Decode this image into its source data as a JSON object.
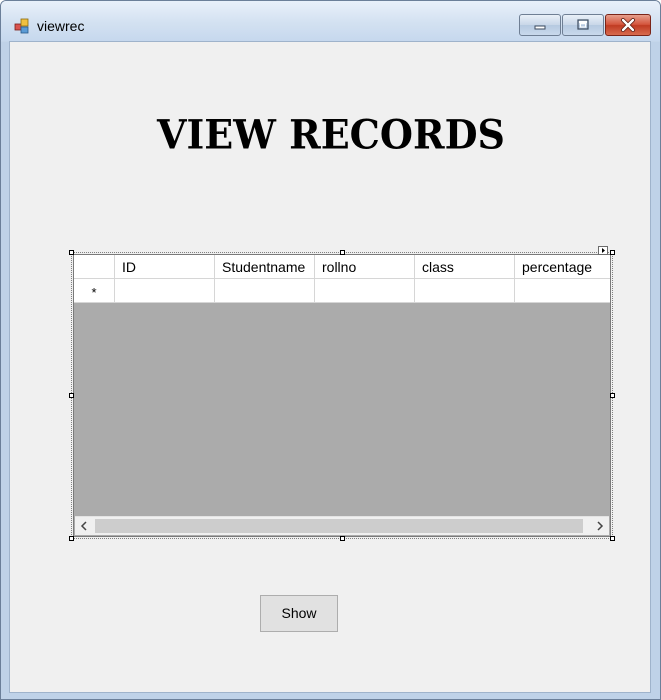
{
  "window": {
    "title": "viewrec",
    "minimize_icon": "minimize-icon",
    "maximize_icon": "maximize-icon",
    "close_icon": "close-icon"
  },
  "heading": "VIEW RECORDS",
  "grid": {
    "columns": [
      "ID",
      "Studentname",
      "rollno",
      "class",
      "percentage"
    ],
    "new_row_marker": "*",
    "rows": []
  },
  "buttons": {
    "show_label": "Show"
  },
  "colors": {
    "grid_background": "#ababab",
    "client_background": "#f0f0f0",
    "close_button": "#c03b22"
  }
}
